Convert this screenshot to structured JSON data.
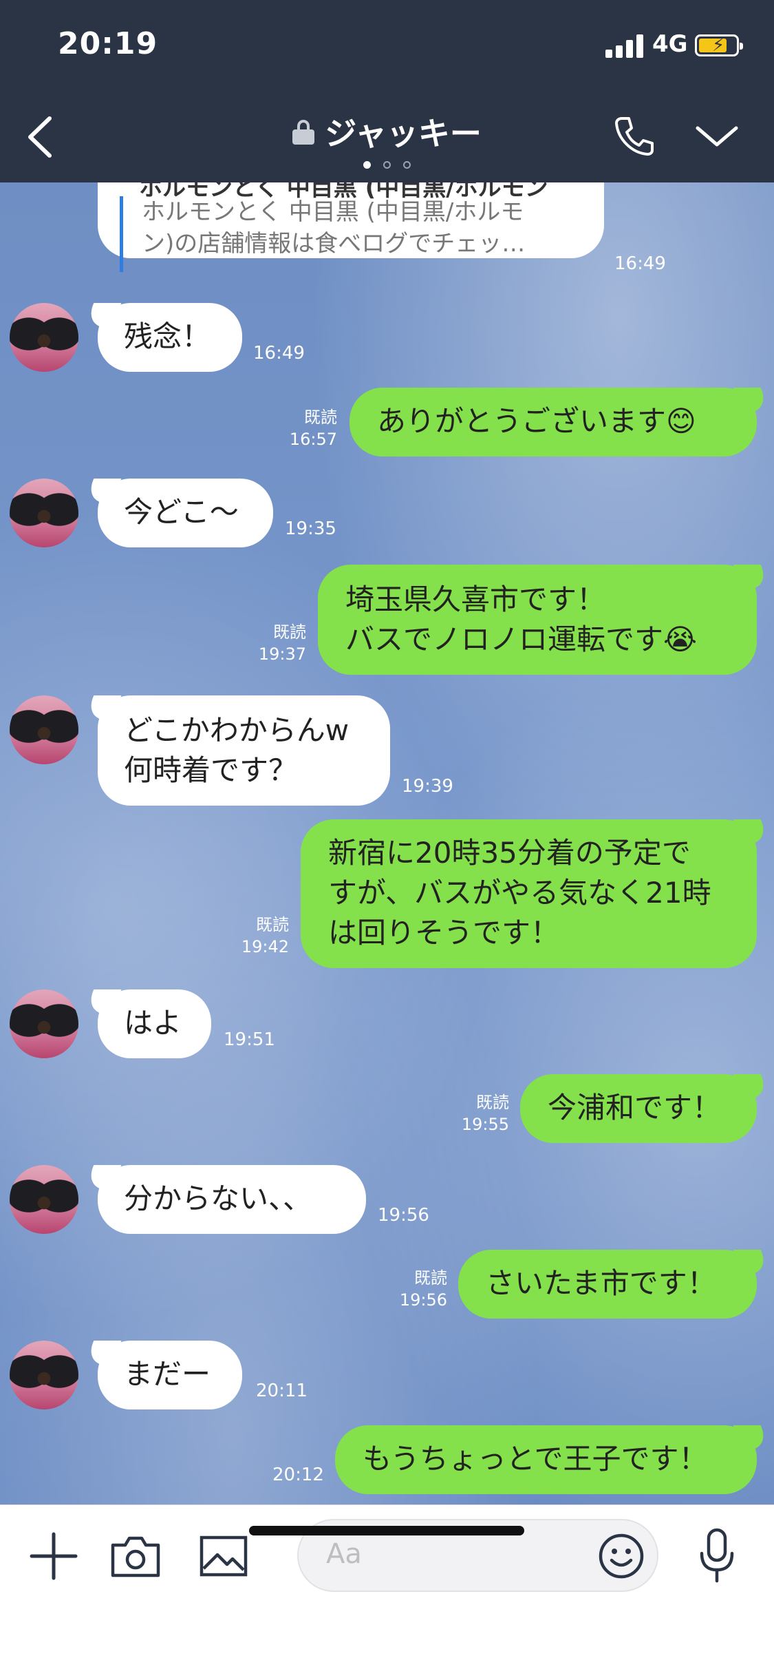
{
  "status": {
    "time": "20:19",
    "network": "4G"
  },
  "header": {
    "title": "ジャッキー",
    "page_dots": 3,
    "active_dot": 0
  },
  "link_card": {
    "title": "ホルモンとく 中目黒 (中目黒/ホルモン",
    "description": "ホルモンとく 中目黒 (中目黒/ホルモ\nン)の店舗情報は食べログでチェッ…",
    "time": "16:49"
  },
  "messages": [
    {
      "side": "left",
      "text": "残念！",
      "time": "16:49"
    },
    {
      "side": "right",
      "text": "ありがとうございます😊",
      "time": "16:57",
      "read": "既読"
    },
    {
      "side": "left",
      "text": "今どこ〜",
      "time": "19:35"
    },
    {
      "side": "right",
      "text": "埼玉県久喜市です！\nバスでノロノロ運転です😭",
      "time": "19:37",
      "read": "既読"
    },
    {
      "side": "left",
      "text": "どこかわからんw\n何時着です？",
      "time": "19:39"
    },
    {
      "side": "right",
      "text": "新宿に20時35分着の予定で\nすが、バスがやる気なく21時\nは回りそうです！",
      "time": "19:42",
      "read": "既読"
    },
    {
      "side": "left",
      "text": "はよ",
      "time": "19:51"
    },
    {
      "side": "right",
      "text": "今浦和です！",
      "time": "19:55",
      "read": "既読"
    },
    {
      "side": "left",
      "text": "分からない、、",
      "time": "19:56"
    },
    {
      "side": "right",
      "text": "さいたま市です！",
      "time": "19:56",
      "read": "既読"
    },
    {
      "side": "left",
      "text": "まだー",
      "time": "20:11"
    },
    {
      "side": "right",
      "text": "もうちょっとで王子です！",
      "time": "20:12"
    }
  ],
  "composer": {
    "placeholder": "Aa"
  },
  "icons": {
    "add": "plus-icon",
    "camera": "camera-icon",
    "image": "image-icon",
    "emoji": "smiley-icon",
    "mic": "microphone-icon"
  },
  "colors": {
    "header_bg": "#2b3445",
    "my_bubble": "#84e14b",
    "their_bubble": "#ffffff",
    "link_bar": "#2f7de1"
  }
}
